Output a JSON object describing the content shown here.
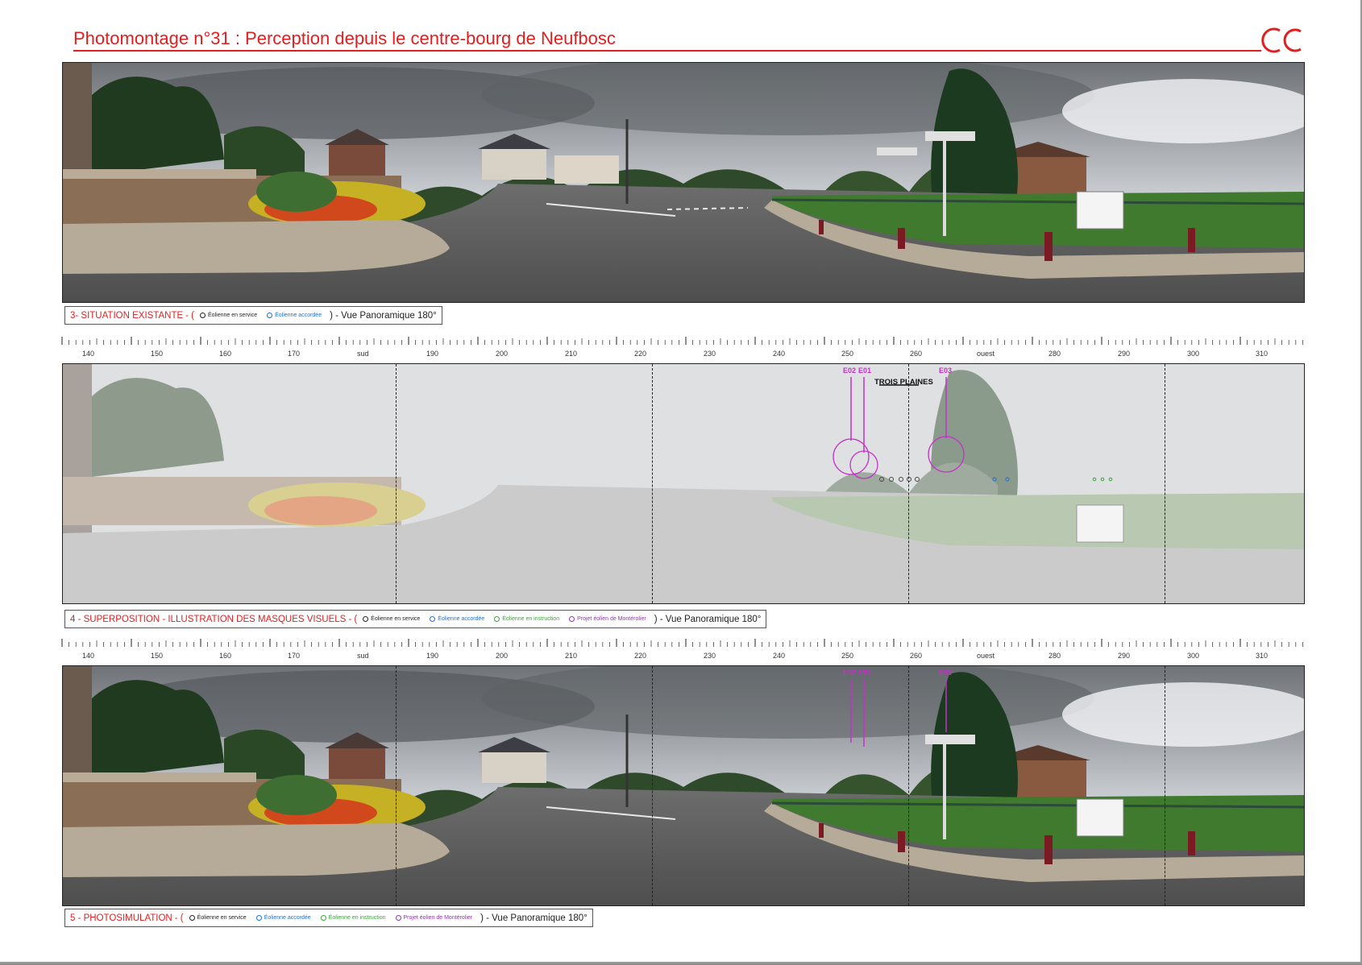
{
  "title": "Photomontage n°31 : Perception depuis le centre-bourg de Neufbosc",
  "logo": "OC",
  "scale": {
    "labels": [
      "140",
      "150",
      "160",
      "170",
      "sud",
      "190",
      "200",
      "210",
      "220",
      "230",
      "240",
      "250",
      "260",
      "ouest",
      "280",
      "290",
      "300",
      "310"
    ]
  },
  "panels": [
    {
      "caption": "3- SITUATION EXISTANTE",
      "legend": [
        {
          "label": "Éolienne en service",
          "color": "#222222"
        },
        {
          "label": "Éolienne accordée",
          "color": "#1f6fd1"
        }
      ],
      "tail": ") - Vue Panoramique 180°"
    },
    {
      "caption": "4 - SUPERPOSITION - ILLUSTRATION DES MASQUES VISUELS",
      "legend": [
        {
          "label": "Éolienne en service",
          "color": "#222222"
        },
        {
          "label": "Éolienne accordée",
          "color": "#1f6fd1"
        },
        {
          "label": "Éolienne en instruction",
          "color": "#3aa43a"
        },
        {
          "label": "Projet éolien de Montérolier",
          "color": "#9a2fb5"
        }
      ],
      "tail": ") - Vue Panoramique 180°"
    },
    {
      "caption": "5 - PHOTOSIMULATION",
      "legend": [
        {
          "label": "Éolienne en service",
          "color": "#222222"
        },
        {
          "label": "Éolienne accordée",
          "color": "#1f6fd1"
        },
        {
          "label": "Éolienne en instruction",
          "color": "#3aa43a"
        },
        {
          "label": "Projet éolien de Montérolier",
          "color": "#9a2fb5"
        }
      ],
      "tail": ") - Vue Panoramique 180°"
    }
  ],
  "turbines": {
    "e02": "E02",
    "e01": "E01",
    "e03": "E03",
    "zone": "TROIS PLAINES"
  },
  "colors": {
    "accent": "#e02020",
    "turbine": "#c233c8"
  }
}
